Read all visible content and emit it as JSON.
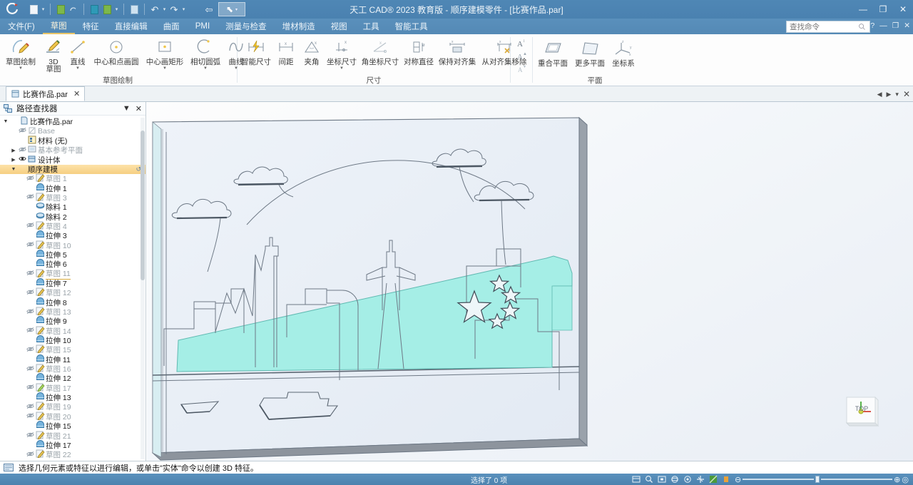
{
  "window": {
    "title": "天工 CAD® 2023 教育版 - 顺序建模零件 - [比赛作品.par]",
    "minimize": "—",
    "restore": "❐",
    "close": "✕"
  },
  "quick_access": {
    "logo": "C",
    "buttons": [
      {
        "name": "new-file-icon",
        "glyph": "▯"
      },
      {
        "name": "new-file-dropdown-icon",
        "glyph": "▾"
      },
      {
        "name": "open-file-icon",
        "glyph": "▰"
      },
      {
        "name": "open-recent-icon",
        "glyph": "◠"
      },
      {
        "name": "save-icon",
        "glyph": "▤"
      },
      {
        "name": "save-as-icon",
        "glyph": "▥"
      },
      {
        "name": "save-dropdown-icon",
        "glyph": "▾"
      },
      {
        "name": "print-icon",
        "glyph": "▤"
      },
      {
        "name": "undo-icon",
        "glyph": "↶"
      },
      {
        "name": "undo-dropdown-icon",
        "glyph": "▾"
      },
      {
        "name": "redo-icon",
        "glyph": "↷"
      },
      {
        "name": "redo-dropdown-icon",
        "glyph": "▾"
      },
      {
        "name": "repeat-icon",
        "glyph": "⇦"
      },
      {
        "name": "select-tool-icon",
        "glyph": "↖"
      },
      {
        "name": "qat-overflow-icon",
        "glyph": "▾"
      }
    ]
  },
  "ribbon_tabs": [
    {
      "label": "文件(F)",
      "active": false
    },
    {
      "label": "草图",
      "active": true
    },
    {
      "label": "特征",
      "active": false
    },
    {
      "label": "直接编辑",
      "active": false
    },
    {
      "label": "曲面",
      "active": false
    },
    {
      "label": "PMI",
      "active": false
    },
    {
      "label": "测量与检查",
      "active": false
    },
    {
      "label": "增材制造",
      "active": false
    },
    {
      "label": "视图",
      "active": false
    },
    {
      "label": "工具",
      "active": false
    },
    {
      "label": "智能工具",
      "active": false
    }
  ],
  "search": {
    "placeholder": "查找命令",
    "value": ""
  },
  "doc_controls": {
    "help": "?",
    "minimize": "—",
    "restore": "❐",
    "close": "✕"
  },
  "ribbon_groups": [
    {
      "name": "draw",
      "label": "草图绘制",
      "commands": [
        {
          "label": "草图绘制",
          "icon": "sketch-icon",
          "dropdown": true
        },
        {
          "label": "3D\n草图",
          "label1": "3D",
          "label2": "草图",
          "icon": "sketch3d-icon",
          "dropdown": false
        },
        {
          "label": "直线",
          "icon": "line-icon",
          "dropdown": true
        },
        {
          "label": "中心和点画圆",
          "icon": "circle-center-point-icon",
          "dropdown": false
        },
        {
          "label": "中心画矩形",
          "icon": "rectangle-center-icon",
          "dropdown": true
        },
        {
          "label": "相切圆弧",
          "icon": "tangent-arc-icon",
          "dropdown": true
        },
        {
          "label": "曲线",
          "icon": "curve-icon",
          "dropdown": true
        }
      ]
    },
    {
      "name": "dimension",
      "label": "尺寸",
      "commands": [
        {
          "label": "智能尺寸",
          "icon": "smart-dimension-icon",
          "dropdown": false
        },
        {
          "label": "间距",
          "icon": "distance-icon",
          "dropdown": false
        },
        {
          "label": "夹角",
          "icon": "angle-icon",
          "dropdown": false
        },
        {
          "label": "坐标尺寸",
          "icon": "coordinate-dimension-icon",
          "dropdown": true
        },
        {
          "label": "角坐标尺寸",
          "icon": "angular-coordinate-icon",
          "dropdown": false
        },
        {
          "label": "对称直径",
          "icon": "symmetric-diameter-icon",
          "dropdown": false
        },
        {
          "label": "保持对齐集",
          "icon": "keep-alignment-icon",
          "dropdown": false
        },
        {
          "label": "从对齐集移除",
          "icon": "remove-alignment-icon",
          "dropdown": false
        }
      ]
    },
    {
      "name": "annotation",
      "label": "",
      "commands": [
        {
          "label": "",
          "icon": "text-style-a-icon",
          "dropdown": false
        },
        {
          "label": "",
          "icon": "text-grow-a-icon",
          "dropdown": false
        },
        {
          "label": "",
          "icon": "text-shrink-a-icon",
          "dropdown": false
        }
      ]
    },
    {
      "name": "plane",
      "label": "平面",
      "commands": [
        {
          "label": "重合平面",
          "icon": "coincident-plane-icon",
          "dropdown": false
        },
        {
          "label": "更多平面",
          "icon": "more-planes-icon",
          "dropdown": false
        },
        {
          "label": "坐标系",
          "icon": "coordinate-system-icon",
          "dropdown": false
        }
      ]
    }
  ],
  "doc_tab": {
    "label": "比赛作品.par",
    "close": "✕"
  },
  "doc_tab_nav": {
    "prev": "◀",
    "next": "▶",
    "menu": "▾",
    "close": "✕"
  },
  "pathfinder": {
    "title": "路径查找器",
    "menu_glyph": "▼",
    "close_glyph": "✕",
    "items": [
      {
        "label": "比赛作品.par",
        "indent": 0,
        "expander": "▼",
        "eye": "",
        "icon": "part-icon",
        "dim": false,
        "highlight": false
      },
      {
        "label": "Base",
        "indent": 1,
        "expander": "",
        "eye": "◍",
        "icon": "base-icon",
        "dim": true,
        "highlight": false
      },
      {
        "label": "材料 (无)",
        "indent": 1,
        "expander": "",
        "eye": "",
        "icon": "material-icon",
        "dim": false,
        "highlight": false
      },
      {
        "label": "基本参考平面",
        "indent": 1,
        "expander": "▶",
        "eye": "◍",
        "icon": "plane-icon",
        "dim": true,
        "highlight": false
      },
      {
        "label": "设计体",
        "indent": 1,
        "expander": "▶",
        "eye": "◉",
        "icon": "body-icon",
        "dim": false,
        "highlight": false
      },
      {
        "label": "顺序建模",
        "indent": 1,
        "expander": "▼",
        "eye": "",
        "icon": "",
        "dim": false,
        "highlight": true
      },
      {
        "label": "草图 1",
        "indent": 2,
        "expander": "",
        "eye": "◍",
        "icon": "sketch-icon",
        "dim": true,
        "highlight": false
      },
      {
        "label": "拉伸 1",
        "indent": 2,
        "expander": "",
        "eye": "",
        "icon": "extrude-icon",
        "dim": false,
        "highlight": false
      },
      {
        "label": "草图 3",
        "indent": 2,
        "expander": "",
        "eye": "◍",
        "icon": "sketch-icon",
        "dim": true,
        "highlight": false
      },
      {
        "label": "除料 1",
        "indent": 2,
        "expander": "",
        "eye": "",
        "icon": "cut-icon",
        "dim": false,
        "highlight": false
      },
      {
        "label": "除料 2",
        "indent": 2,
        "expander": "",
        "eye": "",
        "icon": "cut-icon",
        "dim": false,
        "highlight": false
      },
      {
        "label": "草图 4",
        "indent": 2,
        "expander": "",
        "eye": "◍",
        "icon": "sketch-icon",
        "dim": true,
        "highlight": false
      },
      {
        "label": "拉伸 3",
        "indent": 2,
        "expander": "",
        "eye": "",
        "icon": "extrude-icon",
        "dim": false,
        "highlight": false
      },
      {
        "label": "草图 10",
        "indent": 2,
        "expander": "",
        "eye": "◍",
        "icon": "sketch-icon",
        "dim": true,
        "highlight": false
      },
      {
        "label": "拉伸 5",
        "indent": 2,
        "expander": "",
        "eye": "",
        "icon": "extrude-icon",
        "dim": false,
        "highlight": false
      },
      {
        "label": "拉伸 6",
        "indent": 2,
        "expander": "",
        "eye": "",
        "icon": "extrude-icon",
        "dim": false,
        "highlight": false
      },
      {
        "label": "草图 11",
        "indent": 2,
        "expander": "",
        "eye": "◍",
        "icon": "sketch-icon",
        "dim": true,
        "highlight": false,
        "underline": true
      },
      {
        "label": "拉伸 7",
        "indent": 2,
        "expander": "",
        "eye": "",
        "icon": "extrude-icon",
        "dim": false,
        "highlight": false
      },
      {
        "label": "草图 12",
        "indent": 2,
        "expander": "",
        "eye": "◍",
        "icon": "sketch-icon",
        "dim": true,
        "highlight": false
      },
      {
        "label": "拉伸 8",
        "indent": 2,
        "expander": "",
        "eye": "",
        "icon": "extrude-icon",
        "dim": false,
        "highlight": false
      },
      {
        "label": "草图 13",
        "indent": 2,
        "expander": "",
        "eye": "◍",
        "icon": "sketch-icon",
        "dim": true,
        "highlight": false
      },
      {
        "label": "拉伸 9",
        "indent": 2,
        "expander": "",
        "eye": "",
        "icon": "extrude-icon",
        "dim": false,
        "highlight": false
      },
      {
        "label": "草图 14",
        "indent": 2,
        "expander": "",
        "eye": "◍",
        "icon": "sketch-icon",
        "dim": true,
        "highlight": false
      },
      {
        "label": "拉伸 10",
        "indent": 2,
        "expander": "",
        "eye": "",
        "icon": "extrude-icon",
        "dim": false,
        "highlight": false
      },
      {
        "label": "草图 15",
        "indent": 2,
        "expander": "",
        "eye": "◍",
        "icon": "sketch-icon",
        "dim": true,
        "highlight": false
      },
      {
        "label": "拉伸 11",
        "indent": 2,
        "expander": "",
        "eye": "",
        "icon": "extrude-icon",
        "dim": false,
        "highlight": false
      },
      {
        "label": "草图 16",
        "indent": 2,
        "expander": "",
        "eye": "◍",
        "icon": "sketch-icon",
        "dim": true,
        "highlight": false
      },
      {
        "label": "拉伸 12",
        "indent": 2,
        "expander": "",
        "eye": "",
        "icon": "extrude-icon",
        "dim": false,
        "highlight": false
      },
      {
        "label": "草图 17",
        "indent": 2,
        "expander": "",
        "eye": "◍",
        "icon": "sketch-pin-icon",
        "dim": true,
        "highlight": false
      },
      {
        "label": "拉伸 13",
        "indent": 2,
        "expander": "",
        "eye": "",
        "icon": "extrude-icon",
        "dim": false,
        "highlight": false
      },
      {
        "label": "草图 19",
        "indent": 2,
        "expander": "",
        "eye": "◍",
        "icon": "sketch-icon",
        "dim": true,
        "highlight": false
      },
      {
        "label": "草图 20",
        "indent": 2,
        "expander": "",
        "eye": "◍",
        "icon": "sketch-icon",
        "dim": true,
        "highlight": false
      },
      {
        "label": "拉伸 15",
        "indent": 2,
        "expander": "",
        "eye": "",
        "icon": "extrude-icon",
        "dim": false,
        "highlight": false
      },
      {
        "label": "草图 21",
        "indent": 2,
        "expander": "",
        "eye": "◍",
        "icon": "sketch-icon",
        "dim": true,
        "highlight": false
      },
      {
        "label": "拉伸 17",
        "indent": 2,
        "expander": "",
        "eye": "",
        "icon": "extrude-icon",
        "dim": false,
        "highlight": false
      },
      {
        "label": "草图 22",
        "indent": 2,
        "expander": "",
        "eye": "◍",
        "icon": "sketch-icon",
        "dim": true,
        "highlight": false
      }
    ]
  },
  "viewport": {
    "viewcube_label": "TOP",
    "model_fill": "#e9eff7",
    "highlight_fill": "#a8f0e8",
    "edge_color": "#5a6470"
  },
  "statusbar": {
    "prompt": "选择几何元素或特征以进行编辑，或单击\"实体\"命令以创建 3D 特征。",
    "selection": "选择了 0 项",
    "icons": [
      {
        "name": "select-filter-icon",
        "glyph": "▤"
      },
      {
        "name": "zoom-area-icon",
        "glyph": "⌕"
      },
      {
        "name": "fit-icon",
        "glyph": "▣"
      },
      {
        "name": "rotate-view-icon",
        "glyph": "◎"
      },
      {
        "name": "pan-icon",
        "glyph": "◉"
      },
      {
        "name": "orbit-icon",
        "glyph": "✥"
      },
      {
        "name": "shade-mode-icon",
        "glyph": "▧"
      },
      {
        "name": "display-mode-icon",
        "glyph": "▮"
      }
    ],
    "zoom_out": "⊖",
    "zoom_in": "⊕",
    "zoom_reset": "◎"
  }
}
